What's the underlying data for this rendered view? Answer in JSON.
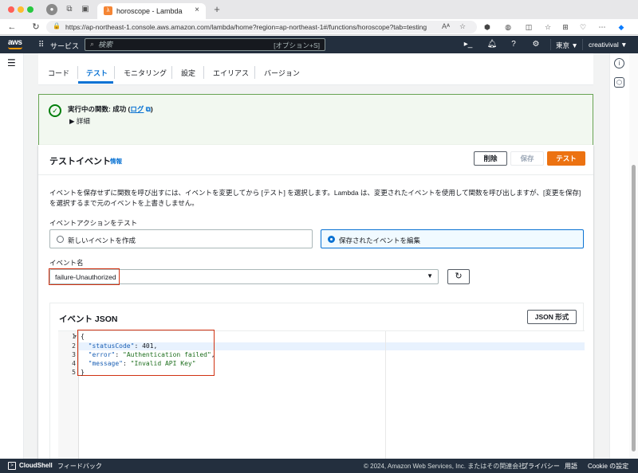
{
  "browser": {
    "tab_title": "horoscope - Lambda",
    "url": "https://ap-northeast-1.console.aws.amazon.com/lambda/home?region=ap-northeast-1#/functions/horoscope?tab=testing"
  },
  "aws_nav": {
    "logo": "aws",
    "services_label": "サービス",
    "search_placeholder": "検索",
    "search_shortcut": "[オプション+S]",
    "region": "東京 ▼",
    "account": "creativival ▼"
  },
  "content_tabs": [
    {
      "label": "コード"
    },
    {
      "label": "テスト"
    },
    {
      "label": "モニタリング"
    },
    {
      "label": "設定"
    },
    {
      "label": "エイリアス"
    },
    {
      "label": "バージョン"
    }
  ],
  "alert": {
    "title_prefix": "実行中の関数: 成功 (",
    "log_link": "ログ",
    "title_suffix": ")",
    "details": "▶ 詳細"
  },
  "test_event": {
    "title": "テストイベント",
    "info": "情報",
    "delete_label": "削除",
    "save_label": "保存",
    "test_label": "テスト",
    "description": "イベントを保存せずに関数を呼び出すには、イベントを変更してから [テスト] を選択します。Lambda は、変更されたイベントを使用して関数を呼び出しますが、[変更を保存] を選択するまで元のイベントを上書きしません。",
    "action_label": "イベントアクションをテスト",
    "option_new": "新しいイベントを作成",
    "option_edit": "保存されたイベントを編集",
    "event_name_label": "イベント名",
    "event_name_value": "failure-Unauthorized"
  },
  "event_json": {
    "title": "イベント JSON",
    "format_button": "JSON 形式",
    "line_numbers": [
      "1",
      "2",
      "3",
      "4",
      "5"
    ],
    "lines": {
      "l1": "{",
      "l2_key": "\"statusCode\"",
      "l2_val": ": 401,",
      "l3_key": "\"error\"",
      "l3_val": "\"Authentication failed\"",
      "l4_key": "\"message\"",
      "l4_val": "\"Invalid API Key\"",
      "l5": "}"
    }
  },
  "footer": {
    "cloudshell": "CloudShell",
    "feedback": "フィードバック",
    "copyright": "© 2024, Amazon Web Services, Inc. またはその関連会社。",
    "privacy": "プライバシー",
    "terms": "用語",
    "cookie": "Cookie の設定"
  },
  "colors": {
    "aws_nav": "#232f3e",
    "aws_orange": "#ec7211",
    "link_blue": "#0972d3",
    "success_green": "#037f0c",
    "highlight_red": "#d13212"
  }
}
